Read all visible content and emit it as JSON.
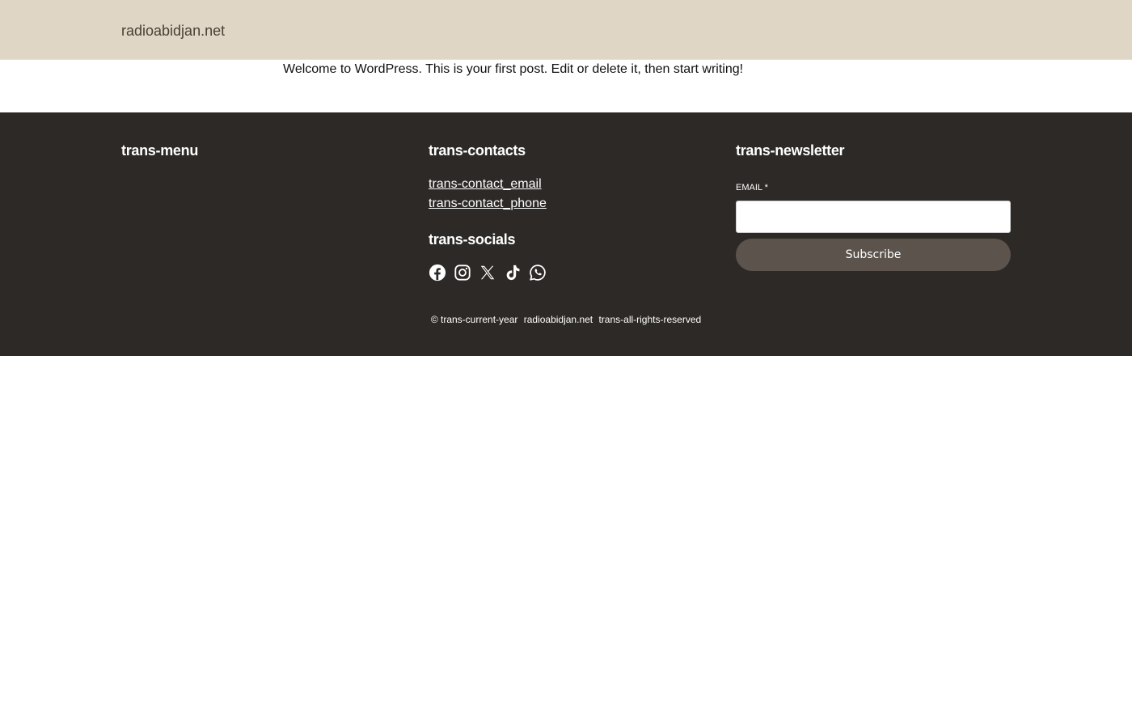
{
  "header": {
    "site_title": "radioabidjan.net"
  },
  "post": {
    "text": "Welcome to WordPress. This is your first post. Edit or delete it, then start writing!"
  },
  "footer": {
    "menu": {
      "heading": "trans-menu"
    },
    "contacts": {
      "heading": "trans-contacts",
      "email_link": "trans-contact_email",
      "phone_link": "trans-contact_phone"
    },
    "socials": {
      "heading": "trans-socials",
      "icons": [
        "facebook-icon",
        "instagram-icon",
        "x-icon",
        "tiktok-icon",
        "whatsapp-icon"
      ]
    },
    "newsletter": {
      "heading": "trans-newsletter",
      "email_label": "EMAIL *",
      "email_value": "",
      "subscribe_label": "Subscribe"
    },
    "copyright": {
      "year": "© trans-current-year",
      "site": "radioabidjan.net",
      "rights": "trans-all-rights-reserved"
    }
  },
  "colors": {
    "header_bg": "#dfd6c5",
    "footer_bg": "#2c2927",
    "button_bg": "#5b534c",
    "site_title": "#4a3f36"
  }
}
